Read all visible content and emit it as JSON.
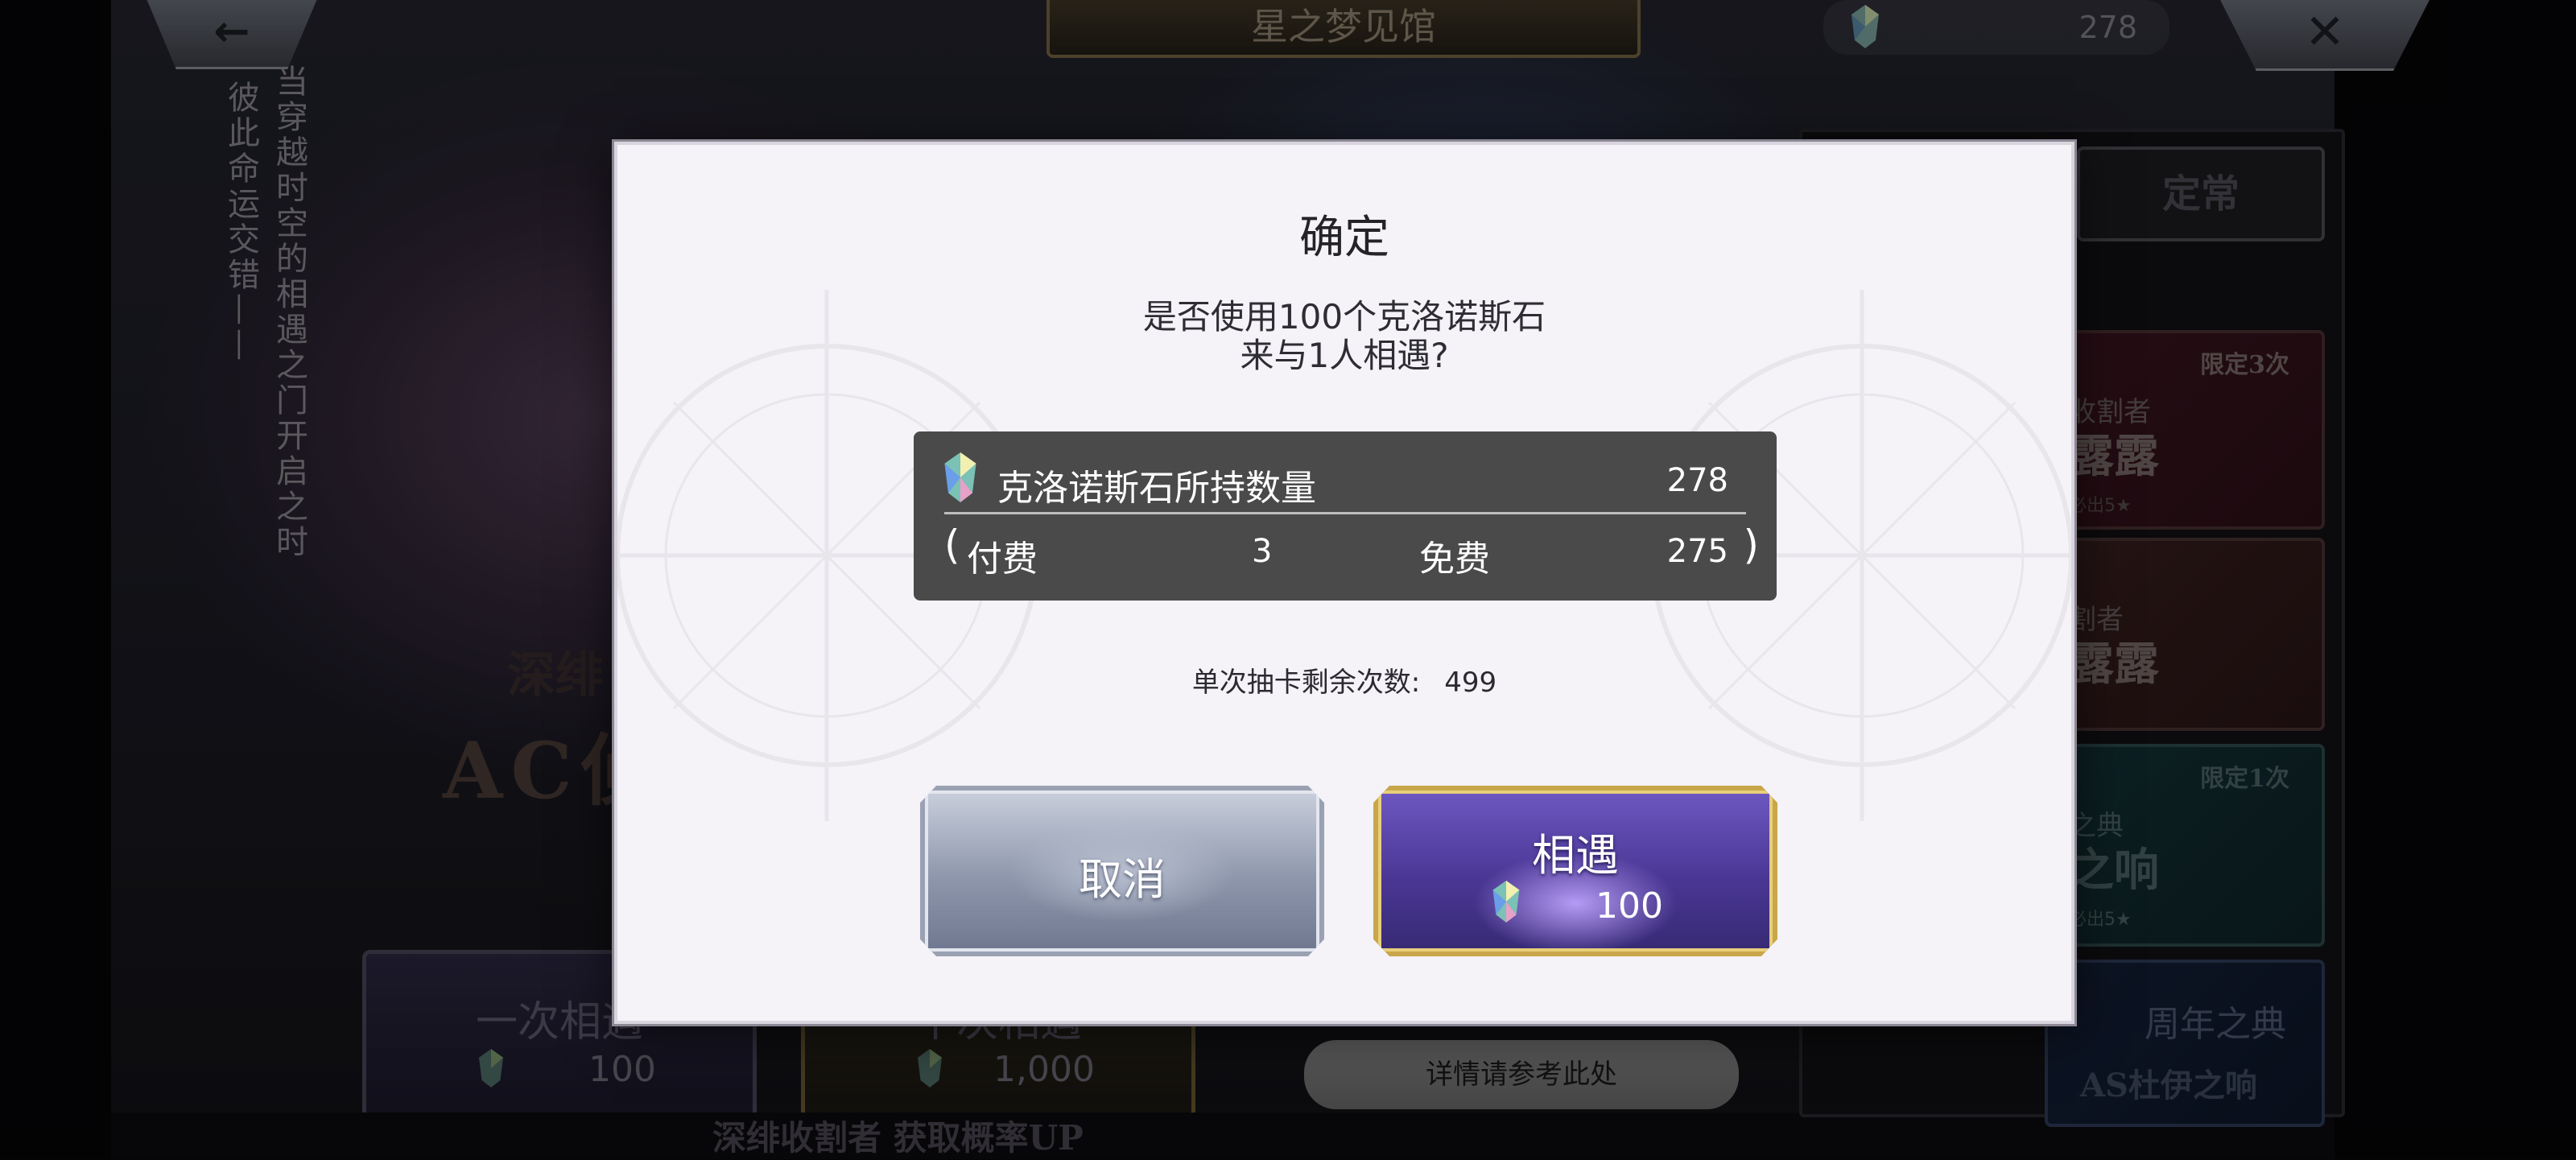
{
  "topbar": {
    "back_label": "←",
    "title": "星之梦见馆",
    "stone_count": "278",
    "close_label": "✕"
  },
  "banner": {
    "vertical_line1": "当穿越时空的相遇之门开启之时",
    "vertical_line2": "彼此命运交错——",
    "subtitle": "深绯",
    "big_text": "AC侦"
  },
  "bottom": {
    "single_pull_label": "一次相遇",
    "single_pull_cost": "100",
    "ten_pull_label": "十次相遇",
    "ten_pull_cost": "1,000",
    "details_label": "详情请参考此处",
    "rate_up": "深绯收割者 获取概率UP"
  },
  "right_panel": {
    "tab_regular": "定常",
    "card1": {
      "tag": "限定3次",
      "line1": "收割者",
      "line2": "露露",
      "line3": "必出5★"
    },
    "card2": {
      "line1": "割者",
      "line2": "露露"
    },
    "card3": {
      "tag": "限定1次",
      "line1": "之典",
      "line2": "之响",
      "line3": "必出5★"
    },
    "card4": {
      "line1": "周年之典",
      "line2": "AS杜伊之响"
    }
  },
  "modal": {
    "title": "确定",
    "message_line1": "是否使用100个克洛诺斯石",
    "message_line2": "来与1人相遇?",
    "owned_label": "克洛诺斯石所持数量",
    "owned_total": "278",
    "paren_open": "(",
    "paren_close": ")",
    "paid_label": "付费",
    "paid_value": "3",
    "free_label": "免费",
    "free_value": "275",
    "remaining_label": "单次抽卡剩余次数:",
    "remaining_value": "499",
    "cancel_label": "取消",
    "confirm_label": "相遇",
    "confirm_cost": "100"
  },
  "icons": {
    "crystal": "chronos-stone-icon",
    "back": "back-arrow-icon",
    "close": "close-icon"
  },
  "colors": {
    "modal_bg": "#f5f3f8",
    "info_box_bg": "#4a4a4b",
    "confirm_gold": "#c9a64a",
    "confirm_purple": "#4a3794",
    "cancel_silver": "#8d96ab"
  }
}
